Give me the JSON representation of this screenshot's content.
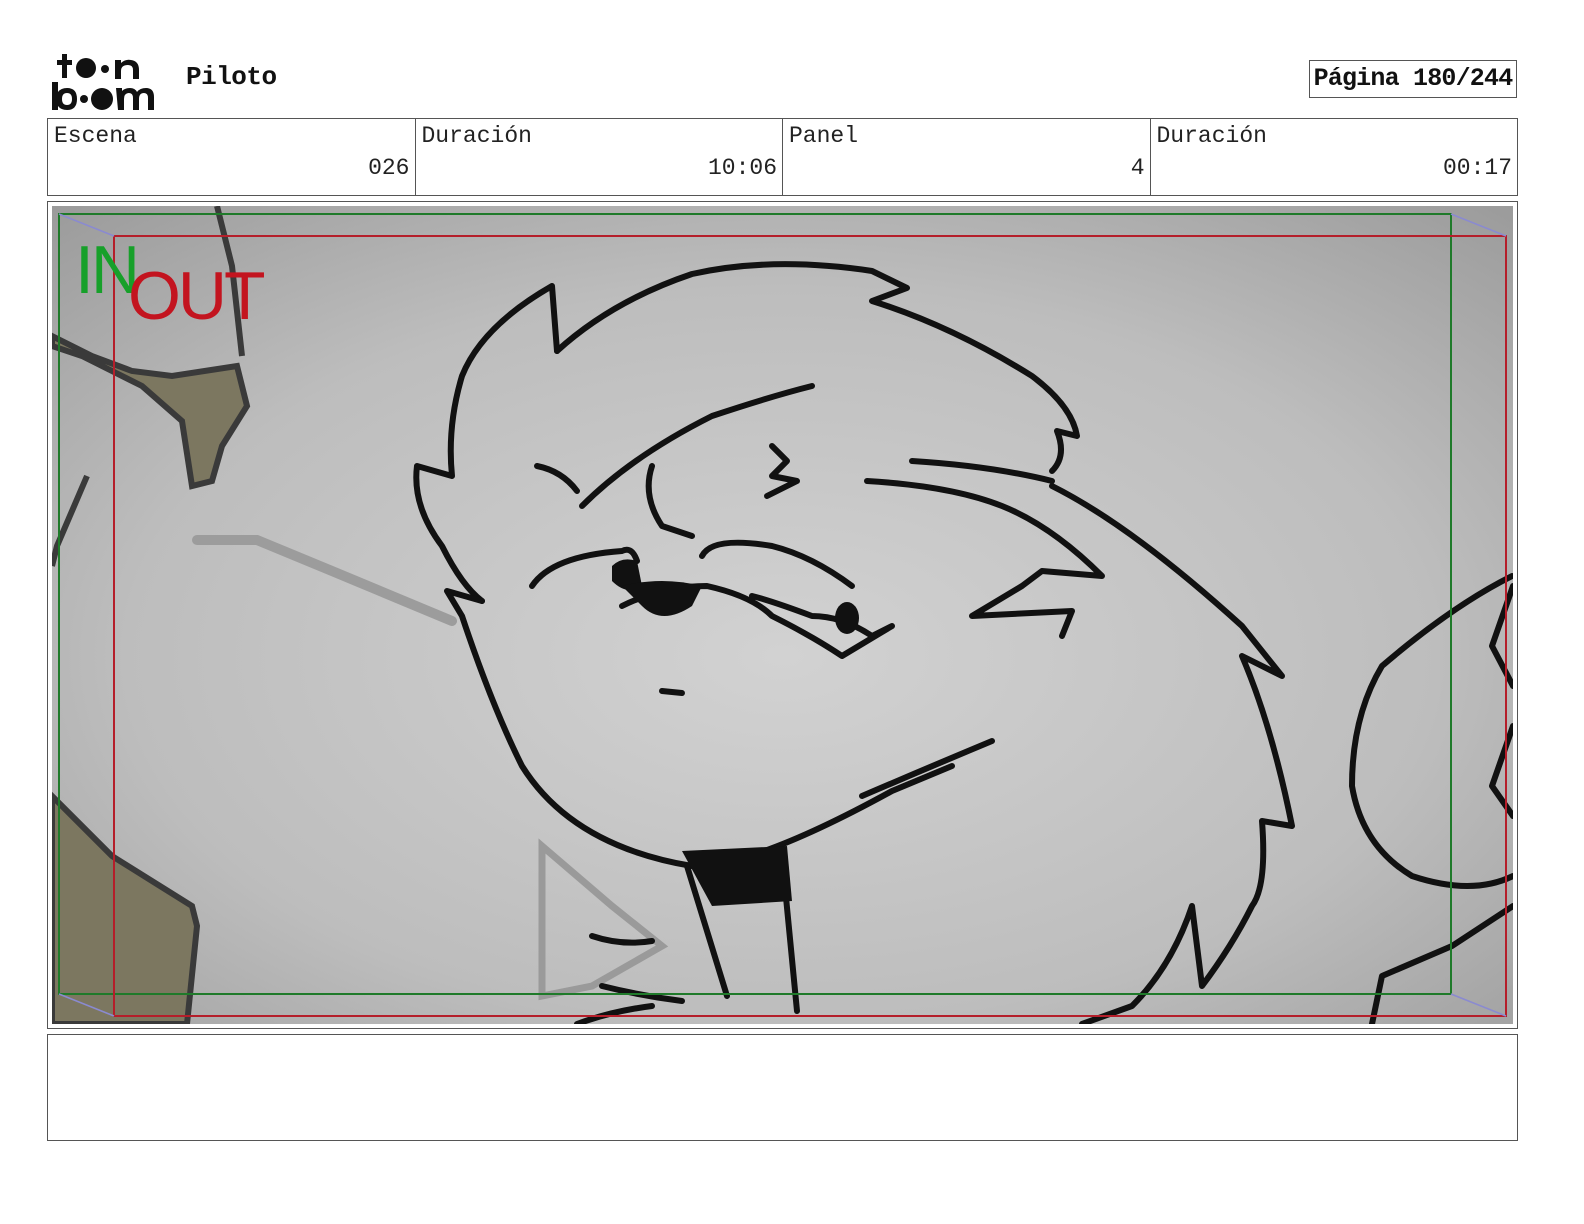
{
  "header": {
    "logo_text": "toon boom",
    "project_title": "Piloto",
    "page_label": "Página 180/244"
  },
  "info": [
    {
      "label": "Escena",
      "value": "026"
    },
    {
      "label": "Duración",
      "value": "10:06"
    },
    {
      "label": "Panel",
      "value": "4"
    },
    {
      "label": "Duración",
      "value": "00:17"
    }
  ],
  "panel": {
    "in_marker": "IN",
    "out_marker": "OUT",
    "in_frame_color": "#1f7a2a",
    "out_frame_color": "#b51e2a"
  },
  "notes": ""
}
